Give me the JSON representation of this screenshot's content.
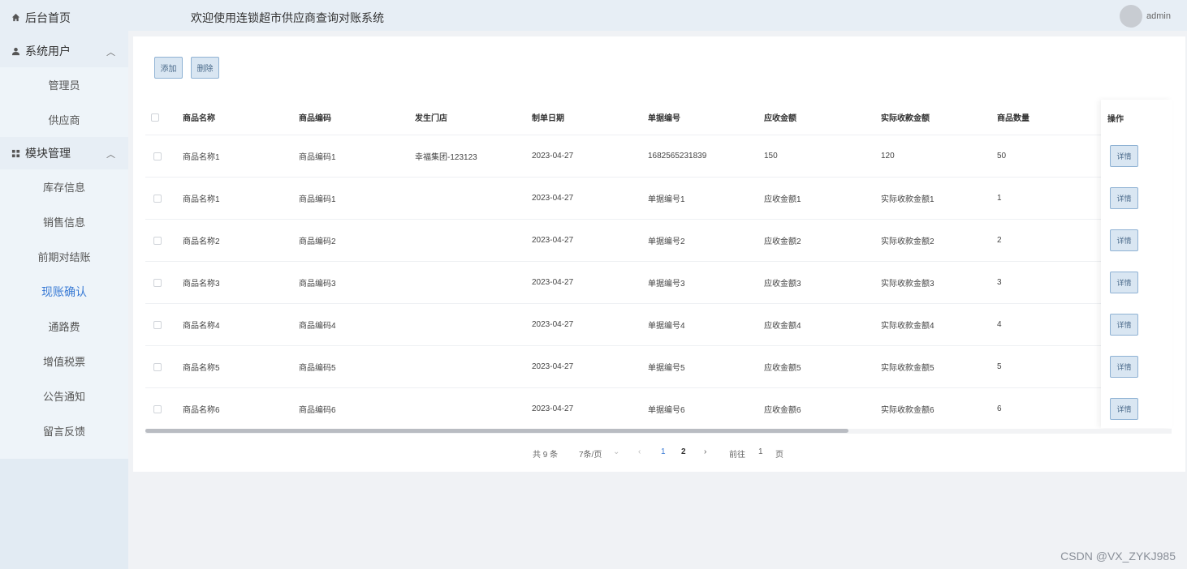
{
  "sidebar": {
    "home": "后台首页",
    "groups": [
      {
        "label": "系统用户",
        "items": [
          "管理员",
          "供应商"
        ]
      },
      {
        "label": "模块管理",
        "items": [
          "库存信息",
          "销售信息",
          "前期对结账",
          "现账确认",
          "通路费",
          "增值税票",
          "公告通知",
          "留言反馈"
        ]
      }
    ],
    "active": "现账确认"
  },
  "header": {
    "title": "欢迎使用连锁超市供应商查询对账系统",
    "user": "admin"
  },
  "toolbar": {
    "add": "添加",
    "delete": "删除"
  },
  "table": {
    "columns": [
      "商品名称",
      "商品编码",
      "发生门店",
      "制单日期",
      "单据编号",
      "应收金额",
      "实际收款金额",
      "商品数量",
      "操作"
    ],
    "rows": [
      [
        "商品名称1",
        "商品编码1",
        "幸福集团-123123",
        "2023-04-27",
        "1682565231839",
        "150",
        "120",
        "50"
      ],
      [
        "商品名称1",
        "商品编码1",
        "",
        "2023-04-27",
        "单据编号1",
        "应收金额1",
        "实际收款金额1",
        "1"
      ],
      [
        "商品名称2",
        "商品编码2",
        "",
        "2023-04-27",
        "单据编号2",
        "应收金额2",
        "实际收款金额2",
        "2"
      ],
      [
        "商品名称3",
        "商品编码3",
        "",
        "2023-04-27",
        "单据编号3",
        "应收金额3",
        "实际收款金额3",
        "3"
      ],
      [
        "商品名称4",
        "商品编码4",
        "",
        "2023-04-27",
        "单据编号4",
        "应收金额4",
        "实际收款金额4",
        "4"
      ],
      [
        "商品名称5",
        "商品编码5",
        "",
        "2023-04-27",
        "单据编号5",
        "应收金额5",
        "实际收款金额5",
        "5"
      ],
      [
        "商品名称6",
        "商品编码6",
        "",
        "2023-04-27",
        "单据编号6",
        "应收金额6",
        "实际收款金额6",
        "6"
      ]
    ],
    "detail_label": "详情"
  },
  "pagination": {
    "total": "共 9 条",
    "page_size": "7条/页",
    "pages": [
      "1",
      "2"
    ],
    "current": "1",
    "goto_label": "前往",
    "goto_value": "1",
    "page_suffix": "页"
  },
  "watermark": "CSDN @VX_ZYKJ985",
  "colors": {
    "accent": "#3a7bd5",
    "sidebar_bg": "#eef4f9",
    "button_bg": "#d9e6f2"
  }
}
